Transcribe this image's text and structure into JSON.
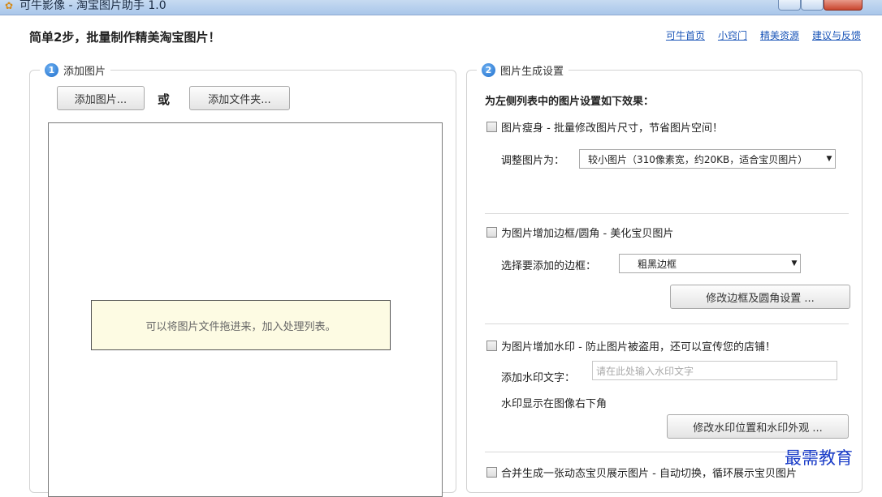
{
  "window": {
    "title": "可牛影像 - 淘宝图片助手 1.0",
    "icon": "app-logo-icon"
  },
  "header": {
    "headline": "简单2步，批量制作精美淘宝图片！",
    "links": [
      "可牛首页",
      "小窍门",
      "精美资源",
      "建议与反馈"
    ]
  },
  "step1": {
    "number": "1",
    "label": "添加图片",
    "add_images_button": "添加图片...",
    "or_text": "或",
    "add_folder_button": "添加文件夹...",
    "drop_tip": "可以将图片文件拖进来，加入处理列表。"
  },
  "step2": {
    "number": "2",
    "label": "图片生成设置",
    "intro": "为左侧列表中的图片设置如下效果：",
    "resize": {
      "checkbox_label": "图片瘦身 - 批量修改图片尺寸，节省图片空间！",
      "field_label": "调整图片为：",
      "selected": "较小图片（310像素宽，约20KB，适合宝贝图片）"
    },
    "border": {
      "checkbox_label": "为图片增加边框/圆角 - 美化宝贝图片",
      "field_label": "选择要添加的边框：",
      "selected": "粗黑边框",
      "settings_button": "修改边框及圆角设置 ..."
    },
    "watermark": {
      "checkbox_label": "为图片增加水印 - 防止图片被盗用，还可以宣传您的店铺！",
      "text_label": "添加水印文字：",
      "text_placeholder": "请在此处输入水印文字",
      "position_text": "水印显示在图像右下角",
      "settings_button": "修改水印位置和水印外观 ..."
    },
    "merge": {
      "checkbox_label": "合并生成一张动态宝贝展示图片 - 自动切换，循环展示宝贝图片"
    }
  },
  "overlay_watermark": "最需教育"
}
